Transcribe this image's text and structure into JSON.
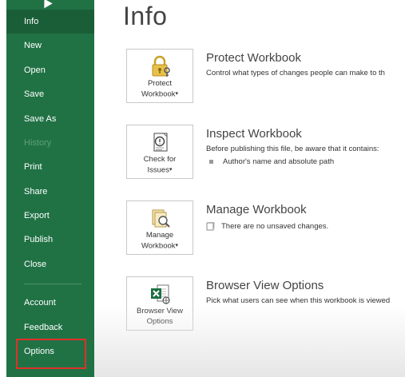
{
  "sidebar": {
    "items": [
      {
        "label": "Info"
      },
      {
        "label": "New"
      },
      {
        "label": "Open"
      },
      {
        "label": "Save"
      },
      {
        "label": "Save As"
      },
      {
        "label": "History"
      },
      {
        "label": "Print"
      },
      {
        "label": "Share"
      },
      {
        "label": "Export"
      },
      {
        "label": "Publish"
      },
      {
        "label": "Close"
      },
      {
        "label": "Account"
      },
      {
        "label": "Feedback"
      },
      {
        "label": "Options"
      }
    ],
    "active_item": "Info",
    "disabled_item": "History",
    "highlighted_item": "Options"
  },
  "main": {
    "title": "Info",
    "sections": [
      {
        "button_line1": "Protect",
        "button_line2": "Workbook",
        "button_has_dropdown": true,
        "button_icon": "lock-key-icon",
        "heading": "Protect Workbook",
        "description": "Control what types of changes people can make to th"
      },
      {
        "button_line1": "Check for",
        "button_line2": "Issues",
        "button_has_dropdown": true,
        "button_icon": "inspect-document-icon",
        "heading": "Inspect Workbook",
        "description": "Before publishing this file, be aware that it contains:",
        "bullet": "Author's name and absolute path"
      },
      {
        "button_line1": "Manage",
        "button_line2": "Workbook",
        "button_has_dropdown": true,
        "button_icon": "manage-workbook-icon",
        "heading": "Manage Workbook",
        "note": "There are no unsaved changes."
      },
      {
        "button_line1": "Browser View",
        "button_line2": "Options",
        "button_has_dropdown": false,
        "button_icon": "excel-browser-view-icon",
        "heading": "Browser View Options",
        "description": "Pick what users can see when this workbook is viewed"
      }
    ]
  },
  "colors": {
    "sidebar_bg": "#207245",
    "sidebar_active_bg": "#1a5e38",
    "highlight_border": "#e0302a",
    "excel_green": "#1d6f42"
  }
}
